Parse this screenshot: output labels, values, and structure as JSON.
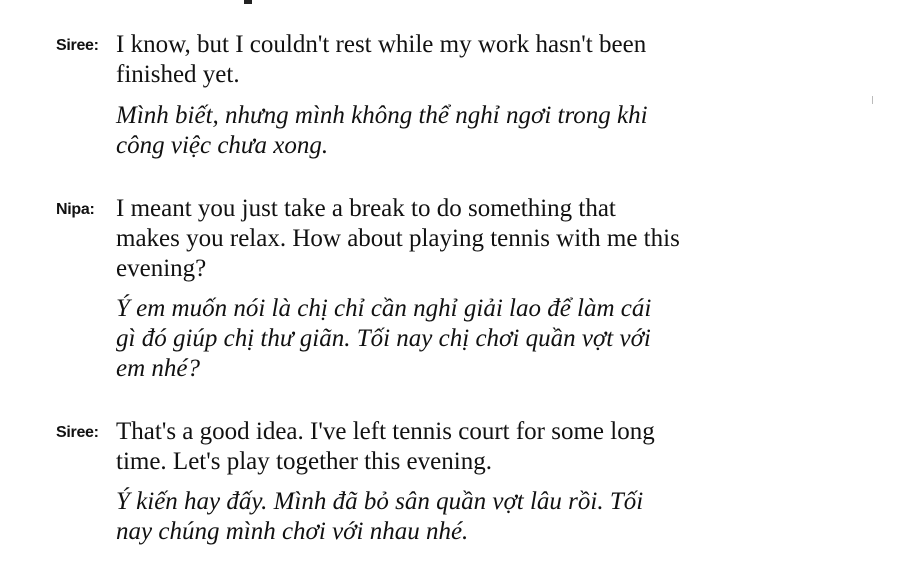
{
  "dialogue": [
    {
      "speaker": "Siree:",
      "english": [
        "I know, but I couldn't rest while my work hasn't been",
        "finished yet."
      ],
      "vietnamese": [
        "Mình biết, nhưng mình không thể nghỉ ngơi trong khi",
        "công việc chưa xong."
      ]
    },
    {
      "speaker": "Nipa:",
      "english": [
        "I meant you just take a break to do something that",
        "makes you relax. How about playing tennis with me this",
        "evening?"
      ],
      "vietnamese": [
        "Ý em muốn nói là chị chỉ cần nghỉ giải lao để làm cái",
        "gì đó giúp chị thư giãn. Tối nay chị chơi quần vợt với",
        "em nhé?"
      ]
    },
    {
      "speaker": "Siree:",
      "english": [
        "That's a good idea. I've left tennis court for some long",
        "time. Let's play together this evening."
      ],
      "vietnamese": [
        "Ý kiến hay đấy. Mình đã bỏ sân quần vợt lâu rồi. Tối",
        "nay chúng mình chơi với nhau nhé."
      ]
    }
  ]
}
